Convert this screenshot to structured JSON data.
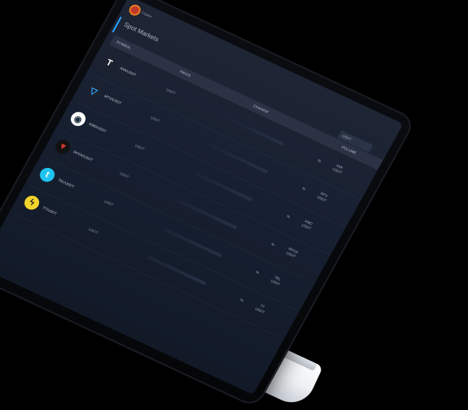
{
  "app": {
    "logo_text": "Cryptex"
  },
  "page": {
    "title": "Spot Markets"
  },
  "table": {
    "headers": {
      "symbol": "SYMBOL",
      "price": "PRICE",
      "change": "CHANGE",
      "volume": "VOLUME"
    },
    "quote_select": "USDT",
    "rows": [
      {
        "pair": "AVA/USDT",
        "price": "USDT",
        "change": "%",
        "vol_asset": "AVA",
        "vol_quote": "USDT",
        "icon": "letter-t-icon",
        "icon_color": "#1c2230",
        "icon_glyph": "T",
        "glyph_color": "#ffffff"
      },
      {
        "pair": "MTV/USDT",
        "price": "USDT",
        "change": "%",
        "vol_asset": "MTV",
        "vol_quote": "USDT",
        "icon": "triangle-icon",
        "icon_color": "#1c2230",
        "icon_glyph": "▽",
        "glyph_color": "#2fa8ff"
      },
      {
        "pair": "KMD/USDT",
        "price": "USDT",
        "change": "%",
        "vol_asset": "KMD",
        "vol_quote": "USDT",
        "icon": "ring-icon",
        "icon_color": "#ffffff",
        "icon_glyph": "◉",
        "glyph_color": "#1b3040"
      },
      {
        "pair": "RFOX/USDT",
        "price": "USDT",
        "change": "%",
        "vol_asset": "RFOX",
        "vol_quote": "USDT",
        "icon": "fox-icon",
        "icon_color": "#111111",
        "icon_glyph": "▼",
        "glyph_color": "#d63b2c"
      },
      {
        "pair": "TEL/USDT",
        "price": "USDT",
        "change": "%",
        "vol_asset": "TEL",
        "vol_quote": "USDT",
        "icon": "telcoin-icon",
        "icon_color": "#20c3f0",
        "icon_glyph": "t",
        "glyph_color": "#ffffff"
      },
      {
        "pair": "TT/USDT",
        "price": "USDT",
        "change": "%",
        "vol_asset": "TT",
        "vol_quote": "USDT",
        "icon": "thunder-icon",
        "icon_color": "#f2d42c",
        "icon_glyph": "ϟ",
        "glyph_color": "#1a1a1a"
      }
    ]
  }
}
